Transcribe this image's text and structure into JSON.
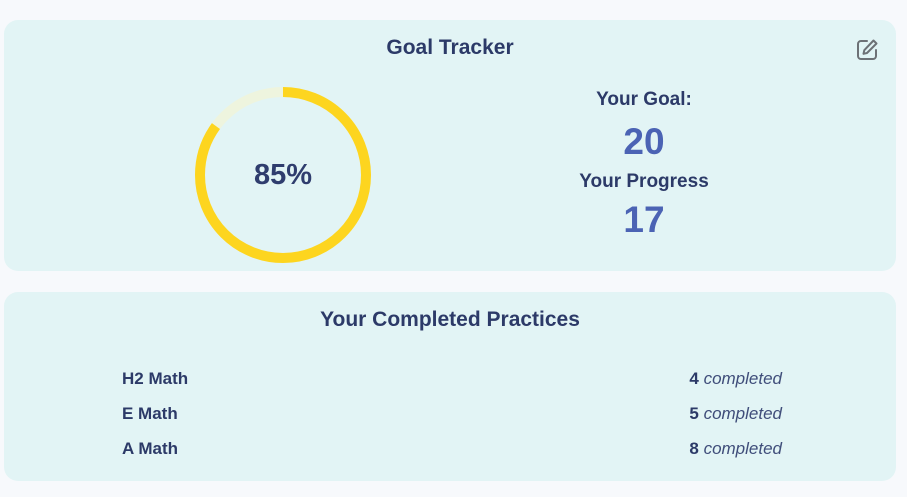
{
  "goal_tracker": {
    "title": "Goal Tracker",
    "edit_icon": "edit-icon",
    "progress_percent_label": "85%",
    "progress_fraction": 0.85,
    "ring_color": "#fdd51f",
    "ring_track_color": "#eef4de",
    "goal_label": "Your Goal:",
    "goal_value": "20",
    "progress_label": "Your Progress",
    "progress_value": "17"
  },
  "practices": {
    "title": "Your Completed Practices",
    "items": [
      {
        "name": "H2 Math",
        "count": "4",
        "suffix": "completed"
      },
      {
        "name": "E Math",
        "count": "5",
        "suffix": "completed"
      },
      {
        "name": "A Math",
        "count": "8",
        "suffix": "completed"
      }
    ]
  }
}
